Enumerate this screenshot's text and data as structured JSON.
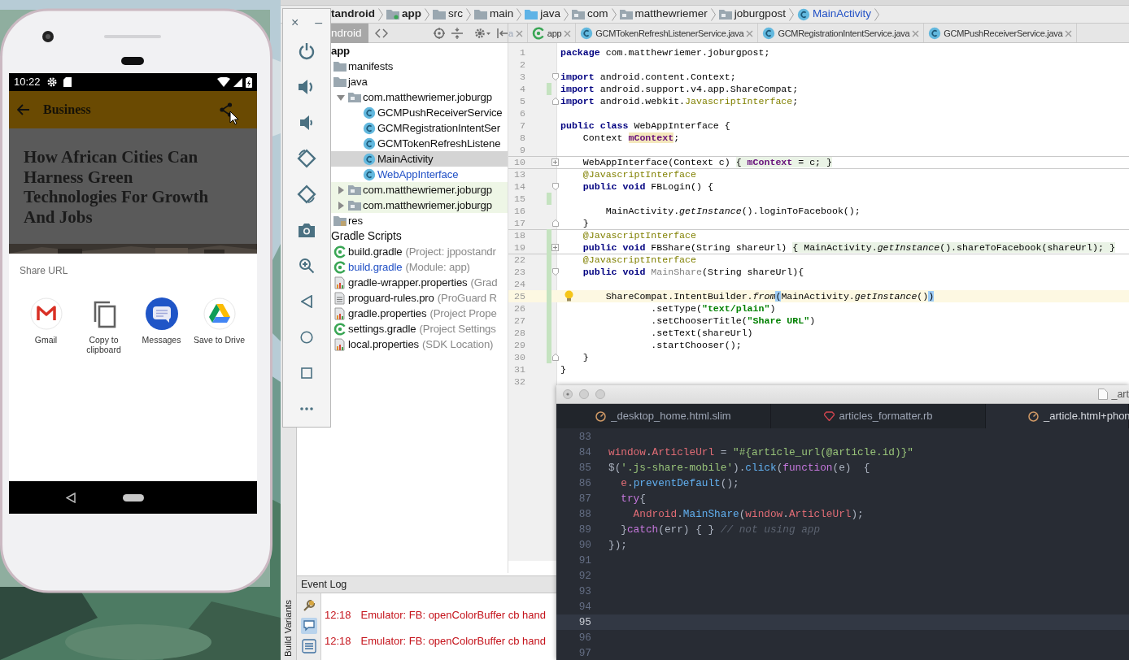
{
  "phone": {
    "status_bar": {
      "time": "10:22"
    },
    "app_bar": {
      "title": "Business"
    },
    "article": {
      "headline": "How African Cities Can Harness Green Technologies For Growth And Jobs"
    },
    "share_sheet": {
      "title": "Share URL",
      "targets": [
        {
          "label": "Gmail",
          "kind": "gmail"
        },
        {
          "label": "Copy to clipboard",
          "kind": "copy"
        },
        {
          "label": "Messages",
          "kind": "messages"
        },
        {
          "label": "Save to Drive",
          "kind": "drive"
        }
      ]
    }
  },
  "emulator_toolbar": {
    "close": "×",
    "minimize": "–",
    "buttons": [
      {
        "kind": "power"
      },
      {
        "kind": "volume_up"
      },
      {
        "kind": "volume_down"
      },
      {
        "kind": "rotate_left"
      },
      {
        "kind": "rotate_right"
      },
      {
        "kind": "camera"
      },
      {
        "kind": "zoom"
      },
      {
        "kind": "back"
      },
      {
        "kind": "home"
      },
      {
        "kind": "overview"
      },
      {
        "kind": "more"
      }
    ]
  },
  "ide": {
    "breadcrumbs": [
      {
        "label": "tandroid",
        "kind": "project"
      },
      {
        "label": "app",
        "kind": "module"
      },
      {
        "label": "src",
        "kind": "folder"
      },
      {
        "label": "main",
        "kind": "folder"
      },
      {
        "label": "java",
        "kind": "source_folder"
      },
      {
        "label": "com",
        "kind": "package"
      },
      {
        "label": "matthewriemer",
        "kind": "package"
      },
      {
        "label": "joburgpost",
        "kind": "package"
      },
      {
        "label": "MainActivity",
        "kind": "class"
      }
    ],
    "project_view": {
      "label": "ndroid"
    },
    "editor_tabs": [
      {
        "label": "a",
        "kind": "partial"
      },
      {
        "label": "app",
        "kind": "gradle"
      },
      {
        "label": "GCMTokenRefreshListenerService.java",
        "kind": "class"
      },
      {
        "label": "GCMRegistrationIntentService.java",
        "kind": "class"
      },
      {
        "label": "GCMPushReceiverService.java",
        "kind": "class"
      }
    ],
    "tree": [
      {
        "label": "app",
        "kind": "module",
        "children": [
          {
            "label": "manifests",
            "kind": "folder"
          },
          {
            "label": "java",
            "kind": "folder",
            "children": [
              {
                "label": "com.matthewriemer.joburgp",
                "kind": "package",
                "expanded": true,
                "children": [
                  {
                    "label": "GCMPushReceiverService",
                    "kind": "class",
                    "selected": false,
                    "modified": false
                  },
                  {
                    "label": "GCMRegistrationIntentSer",
                    "kind": "class",
                    "selected": false,
                    "modified": false
                  },
                  {
                    "label": "GCMTokenRefreshListene",
                    "kind": "class",
                    "selected": false,
                    "modified": false
                  },
                  {
                    "label": "MainActivity",
                    "kind": "class",
                    "selected": true,
                    "modified": false
                  },
                  {
                    "label": "WebAppInterface",
                    "kind": "class",
                    "selected": false,
                    "modified": true
                  }
                ]
              },
              {
                "label": "com.matthewriemer.joburgp",
                "kind": "test_package",
                "expanded": false
              },
              {
                "label": "com.matthewriemer.joburgp",
                "kind": "test_package",
                "expanded": false
              }
            ]
          },
          {
            "label": "res",
            "kind": "res_folder"
          }
        ]
      },
      {
        "label": "Gradle Scripts",
        "kind": "group",
        "children": [
          {
            "label": "build.gradle",
            "note": "(Project: jppostandr",
            "kind": "gradle",
            "modified": false
          },
          {
            "label": "build.gradle",
            "note": "(Module: app)",
            "kind": "gradle",
            "modified": true
          },
          {
            "label": "gradle-wrapper.properties",
            "note": "(Grad",
            "kind": "properties",
            "modified": false
          },
          {
            "label": "proguard-rules.pro",
            "note": "(ProGuard R",
            "kind": "text",
            "modified": false
          },
          {
            "label": "gradle.properties",
            "note": "(Project Prope",
            "kind": "properties",
            "modified": false
          },
          {
            "label": "settings.gradle",
            "note": "(Project Settings",
            "kind": "gradle",
            "modified": false
          },
          {
            "label": "local.properties",
            "note": "(SDK Location)",
            "kind": "properties",
            "modified": false
          }
        ]
      }
    ],
    "code_lines": [
      {
        "number": "1",
        "kind": "plain",
        "current": false,
        "changed": false,
        "tokens": [
          {
            "text": "package",
            "kind": "keyword"
          },
          {
            "text": " com.matthewriemer.joburgpost;",
            "kind": "plain"
          }
        ]
      },
      {
        "number": "2",
        "kind": "plain",
        "current": false,
        "changed": false
      },
      {
        "number": "3",
        "kind": "fold_start",
        "current": false,
        "changed": false,
        "tokens": [
          {
            "text": "import",
            "kind": "keyword"
          },
          {
            "text": " android.content.Context;",
            "kind": "plain"
          }
        ]
      },
      {
        "number": "4",
        "kind": "plain",
        "current": false,
        "changed": true,
        "tokens": [
          {
            "text": "import",
            "kind": "keyword"
          },
          {
            "text": " android.support.v4.app.ShareCompat;",
            "kind": "plain"
          }
        ]
      },
      {
        "number": "5",
        "kind": "fold_end",
        "current": false,
        "changed": false,
        "tokens": [
          {
            "text": "import",
            "kind": "keyword"
          },
          {
            "text": " android.webkit.",
            "kind": "plain"
          },
          {
            "text": "JavascriptInterface",
            "kind": "annotation"
          },
          {
            "text": ";",
            "kind": "plain"
          }
        ]
      },
      {
        "number": "6",
        "kind": "plain",
        "current": false,
        "changed": false
      },
      {
        "number": "7",
        "kind": "plain",
        "current": false,
        "changed": false,
        "tokens": [
          {
            "text": "public class",
            "kind": "keyword"
          },
          {
            "text": " WebAppInterface {",
            "kind": "plain"
          }
        ]
      },
      {
        "number": "8",
        "kind": "plain",
        "current": false,
        "changed": false,
        "tokens": [
          {
            "text": "    Context ",
            "kind": "plain"
          },
          {
            "text": "mContext",
            "kind": "field_usage"
          },
          {
            "text": ";",
            "kind": "plain"
          }
        ]
      },
      {
        "number": "9",
        "kind": "plain",
        "current": false,
        "changed": false
      },
      {
        "number": "10",
        "kind": "folded",
        "current": false,
        "changed": false,
        "separator": true,
        "tokens": [
          {
            "text": "    WebAppInterface(Context c) ",
            "kind": "plain"
          },
          {
            "text": "{ ",
            "kind": "folded"
          },
          {
            "text": "mContext",
            "kind": "folded_field"
          },
          {
            "text": " = c; }",
            "kind": "folded"
          }
        ]
      },
      {
        "number": "13",
        "kind": "plain",
        "current": false,
        "changed": false,
        "separator": true,
        "tokens": [
          {
            "text": "    @JavascriptInterface",
            "kind": "annotation"
          }
        ]
      },
      {
        "number": "14",
        "kind": "fold_start",
        "current": false,
        "changed": false,
        "tokens": [
          {
            "text": "    public void",
            "kind": "keyword"
          },
          {
            "text": " FBLogin() {",
            "kind": "plain"
          }
        ]
      },
      {
        "number": "15",
        "kind": "plain",
        "current": false,
        "changed": true
      },
      {
        "number": "16",
        "kind": "plain",
        "current": false,
        "changed": false,
        "tokens": [
          {
            "text": "        MainActivity.",
            "kind": "plain"
          },
          {
            "text": "getInstance",
            "kind": "italic"
          },
          {
            "text": "().loginToFacebook();",
            "kind": "plain"
          }
        ]
      },
      {
        "number": "17",
        "kind": "fold_end",
        "current": false,
        "changed": false,
        "tokens": [
          {
            "text": "    }",
            "kind": "plain"
          }
        ]
      },
      {
        "number": "18",
        "kind": "plain",
        "current": false,
        "changed": true,
        "separator": true,
        "tokens": [
          {
            "text": "    @JavascriptInterface",
            "kind": "annotation"
          }
        ]
      },
      {
        "number": "19",
        "kind": "folded",
        "current": false,
        "changed": true,
        "tokens": [
          {
            "text": "    public void",
            "kind": "keyword"
          },
          {
            "text": " FBShare(String shareUrl) ",
            "kind": "plain"
          },
          {
            "text": "{ MainActivity.",
            "kind": "folded"
          },
          {
            "text": "getInstance",
            "kind": "folded_italic"
          },
          {
            "text": "().shareToFacebook(shareUrl); }",
            "kind": "folded"
          }
        ]
      },
      {
        "number": "22",
        "kind": "plain",
        "current": false,
        "changed": true,
        "separator": true,
        "tokens": [
          {
            "text": "    @JavascriptInterface",
            "kind": "annotation"
          }
        ]
      },
      {
        "number": "23",
        "kind": "fold_start",
        "current": false,
        "changed": true,
        "tokens": [
          {
            "text": "    public void",
            "kind": "keyword"
          },
          {
            "text": " MainShare",
            "kind": "unused"
          },
          {
            "text": "(String shareUrl){",
            "kind": "plain"
          }
        ]
      },
      {
        "number": "24",
        "kind": "plain",
        "current": false,
        "changed": true
      },
      {
        "number": "25",
        "kind": "plain",
        "current": true,
        "changed": true,
        "hint": true,
        "tokens": [
          {
            "text": "        ShareCompat.IntentBuilder.",
            "kind": "plain"
          },
          {
            "text": "from",
            "kind": "italic"
          },
          {
            "text": "(",
            "kind": "bracket_match"
          },
          {
            "text": "MainActivity.",
            "kind": "plain"
          },
          {
            "text": "getInstance",
            "kind": "italic"
          },
          {
            "text": "()",
            "kind": "plain"
          },
          {
            "text": ")",
            "kind": "bracket_match"
          }
        ]
      },
      {
        "number": "26",
        "kind": "plain",
        "current": false,
        "changed": true,
        "tokens": [
          {
            "text": "                .setType(",
            "kind": "plain"
          },
          {
            "text": "\"text/plain\"",
            "kind": "string"
          },
          {
            "text": ")",
            "kind": "plain"
          }
        ]
      },
      {
        "number": "27",
        "kind": "plain",
        "current": false,
        "changed": true,
        "tokens": [
          {
            "text": "                .setChooserTitle(",
            "kind": "plain"
          },
          {
            "text": "\"Share URL\"",
            "kind": "string"
          },
          {
            "text": ")",
            "kind": "plain"
          }
        ]
      },
      {
        "number": "28",
        "kind": "plain",
        "current": false,
        "changed": true,
        "tokens": [
          {
            "text": "                .setText(shareUrl)",
            "kind": "plain"
          }
        ]
      },
      {
        "number": "29",
        "kind": "plain",
        "current": false,
        "changed": true,
        "tokens": [
          {
            "text": "                .startChooser();",
            "kind": "plain"
          }
        ]
      },
      {
        "number": "30",
        "kind": "fold_end",
        "current": false,
        "changed": true,
        "tokens": [
          {
            "text": "    }",
            "kind": "plain"
          }
        ]
      },
      {
        "number": "31",
        "kind": "plain",
        "current": false,
        "changed": false,
        "tokens": [
          {
            "text": "}",
            "kind": "plain"
          }
        ]
      },
      {
        "number": "32",
        "kind": "plain",
        "current": false,
        "changed": false
      }
    ],
    "event_log": {
      "title": "Event Log",
      "entries": [
        {
          "time": "12:18",
          "message": "Emulator: FB: openColorBuffer cb hand"
        },
        {
          "time": "12:18",
          "message": "Emulator: FB: openColorBuffer cb hand"
        }
      ]
    },
    "side_tab": "Build Variants"
  },
  "text_editor": {
    "title": "_art",
    "tabs": [
      {
        "label": "_desktop_home.html.slim",
        "kind": "slim",
        "selected": false
      },
      {
        "label": "articles_formatter.rb",
        "kind": "ruby",
        "selected": false
      },
      {
        "label": "_article.html+phon",
        "kind": "slim",
        "selected": true
      }
    ],
    "lines": [
      {
        "number": "83",
        "current": false
      },
      {
        "number": "84",
        "current": false,
        "tokens": [
          {
            "text": "window",
            "kind": "variable"
          },
          {
            "text": ".",
            "kind": "plain"
          },
          {
            "text": "ArticleUrl",
            "kind": "variable"
          },
          {
            "text": " = ",
            "kind": "plain"
          },
          {
            "text": "\"#{article_url(@article.id)}\"",
            "kind": "string"
          }
        ]
      },
      {
        "number": "85",
        "current": false,
        "tokens": [
          {
            "text": "$(",
            "kind": "plain"
          },
          {
            "text": "'.js-share-mobile'",
            "kind": "string"
          },
          {
            "text": ").",
            "kind": "plain"
          },
          {
            "text": "click",
            "kind": "function"
          },
          {
            "text": "(",
            "kind": "plain"
          },
          {
            "text": "function",
            "kind": "keyword"
          },
          {
            "text": "(e)  {",
            "kind": "plain"
          }
        ]
      },
      {
        "number": "86",
        "current": false,
        "tokens": [
          {
            "text": "  e",
            "kind": "variable"
          },
          {
            "text": ".",
            "kind": "plain"
          },
          {
            "text": "preventDefault",
            "kind": "function"
          },
          {
            "text": "();",
            "kind": "plain"
          }
        ]
      },
      {
        "number": "87",
        "current": false,
        "tokens": [
          {
            "text": "  try",
            "kind": "keyword"
          },
          {
            "text": "{",
            "kind": "plain"
          }
        ]
      },
      {
        "number": "88",
        "current": false,
        "tokens": [
          {
            "text": "    Android",
            "kind": "variable"
          },
          {
            "text": ".",
            "kind": "plain"
          },
          {
            "text": "MainShare",
            "kind": "function"
          },
          {
            "text": "(",
            "kind": "plain"
          },
          {
            "text": "window",
            "kind": "variable"
          },
          {
            "text": ".",
            "kind": "plain"
          },
          {
            "text": "ArticleUrl",
            "kind": "variable"
          },
          {
            "text": ");",
            "kind": "plain"
          }
        ]
      },
      {
        "number": "89",
        "current": false,
        "tokens": [
          {
            "text": "  }",
            "kind": "plain"
          },
          {
            "text": "catch",
            "kind": "keyword"
          },
          {
            "text": "(err) { } ",
            "kind": "plain"
          },
          {
            "text": "// not using app",
            "kind": "comment"
          }
        ]
      },
      {
        "number": "90",
        "current": false,
        "tokens": [
          {
            "text": "});",
            "kind": "plain"
          }
        ]
      },
      {
        "number": "91",
        "current": false
      },
      {
        "number": "92",
        "current": false
      },
      {
        "number": "93",
        "current": false
      },
      {
        "number": "94",
        "current": false
      },
      {
        "number": "95",
        "current": true
      },
      {
        "number": "96",
        "current": false
      },
      {
        "number": "97",
        "current": false
      }
    ]
  }
}
